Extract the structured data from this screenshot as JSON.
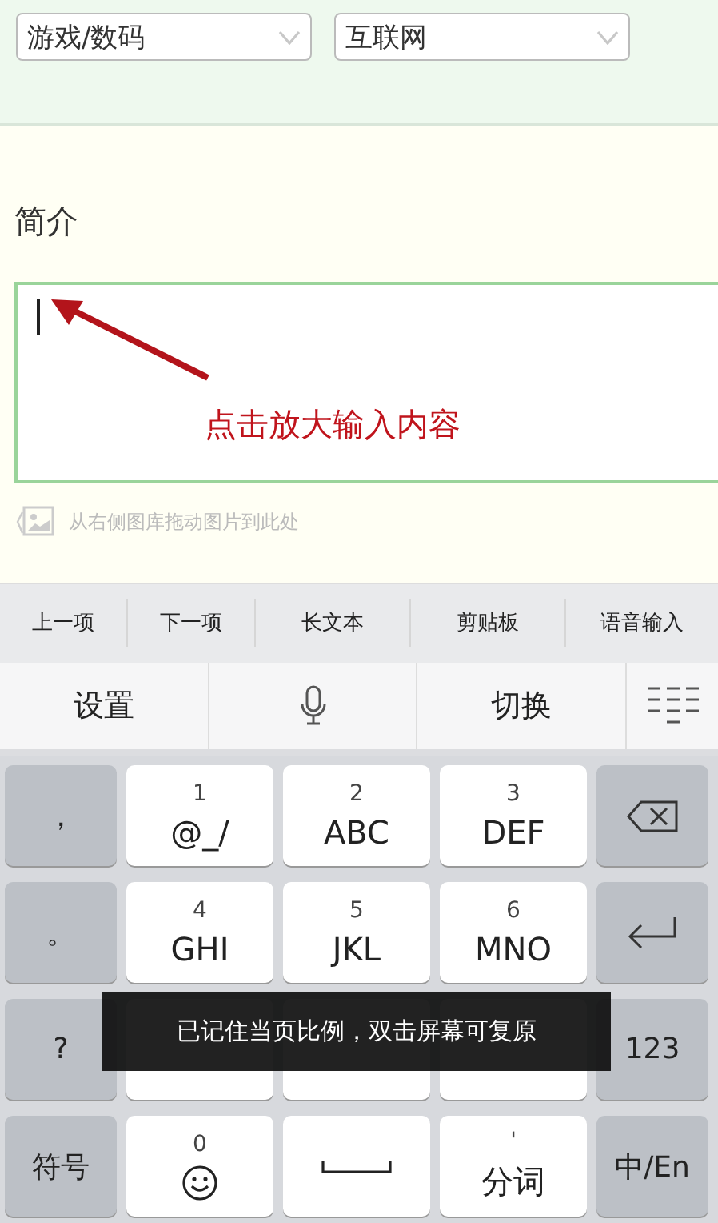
{
  "category_selects": [
    {
      "value": "游戏/数码"
    },
    {
      "value": "互联网"
    }
  ],
  "intro": {
    "label": "简介",
    "annotation": "点击放大输入内容",
    "image_hint": "从右侧图库拖动图片到此处"
  },
  "toolbar": [
    "上一项",
    "下一项",
    "长文本",
    "剪贴板",
    "语音输入"
  ],
  "function_row": [
    {
      "kind": "text",
      "label": "设置"
    },
    {
      "kind": "mic"
    },
    {
      "kind": "text",
      "label": "切换"
    },
    {
      "kind": "menu"
    }
  ],
  "keys": [
    [
      {
        "kind": "side",
        "label": "，"
      },
      {
        "kind": "main",
        "digit": "1",
        "label": "@_/"
      },
      {
        "kind": "main",
        "digit": "2",
        "label": "ABC"
      },
      {
        "kind": "main",
        "digit": "3",
        "label": "DEF"
      },
      {
        "kind": "backspace"
      }
    ],
    [
      {
        "kind": "side",
        "label": "。"
      },
      {
        "kind": "main",
        "digit": "4",
        "label": "GHI"
      },
      {
        "kind": "main",
        "digit": "5",
        "label": "JKL"
      },
      {
        "kind": "main",
        "digit": "6",
        "label": "MNO"
      },
      {
        "kind": "enter"
      }
    ],
    [
      {
        "kind": "side",
        "label": "?"
      },
      {
        "kind": "covered"
      },
      {
        "kind": "covered"
      },
      {
        "kind": "covered"
      },
      {
        "kind": "side",
        "label": "123"
      }
    ],
    [
      {
        "kind": "side",
        "label": "符号"
      },
      {
        "kind": "emoji",
        "digit": "0"
      },
      {
        "kind": "space"
      },
      {
        "kind": "main",
        "digit": "'",
        "label": "分词"
      },
      {
        "kind": "side",
        "label": "中/En"
      }
    ]
  ],
  "toast": "已记住当页比例，双击屏幕可复原"
}
